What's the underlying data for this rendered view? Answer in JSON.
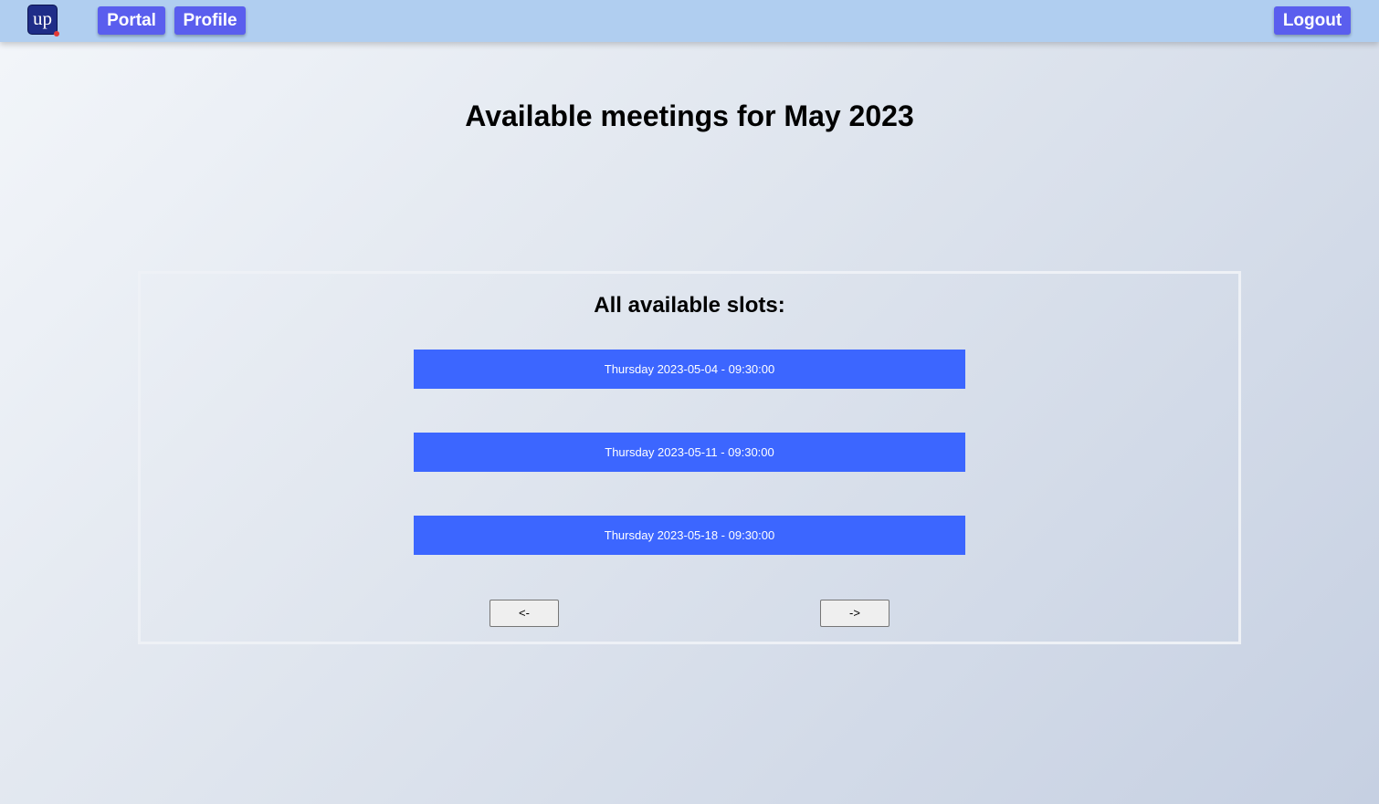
{
  "navbar": {
    "logo_text": "up",
    "portal_label": "Portal",
    "profile_label": "Profile",
    "logout_label": "Logout"
  },
  "page_title": "Available meetings for May 2023",
  "slots_panel": {
    "title": "All available slots:",
    "slots": [
      "Thursday 2023-05-04 - 09:30:00",
      "Thursday 2023-05-11 - 09:30:00",
      "Thursday 2023-05-18 - 09:30:00"
    ],
    "prev_label": "<-",
    "next_label": "->"
  },
  "colors": {
    "navbar_bg": "#b0cef0",
    "nav_button": "#5a5eee",
    "slot_button": "#3c66ff",
    "logo_bg": "#1f2d88"
  }
}
